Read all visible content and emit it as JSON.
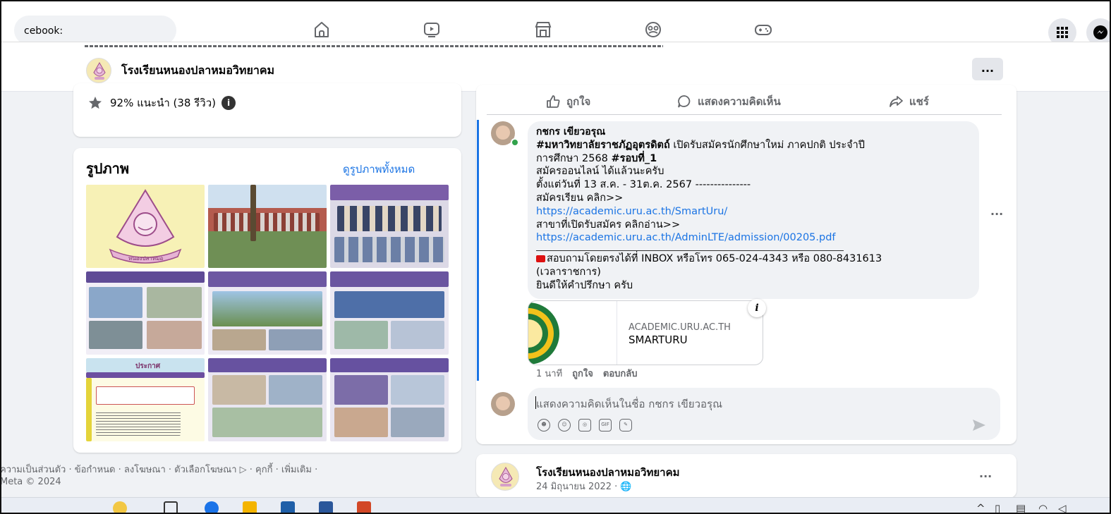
{
  "topnav": {
    "search_text": "cebook:",
    "nav_icons": [
      "home-icon",
      "video-icon",
      "marketplace-icon",
      "groups-icon",
      "gaming-icon"
    ],
    "right_icons": [
      "apps-grid-icon",
      "messenger-icon"
    ]
  },
  "page_header": {
    "name": "โรงเรียนหนองปลาหมอวิทยาคม",
    "more_label": "..."
  },
  "intro": {
    "rating_text": "92% แนะนำ (38 รีวิว)"
  },
  "photos": {
    "title": "รูปภาพ",
    "see_all": "ดูรูปภาพทั้งหมด",
    "tile_texts": {
      "logo_caption": "หนองปลาหมอ",
      "announce": "ประกาศ"
    }
  },
  "footer": {
    "line1": "ความเป็นส่วนตัว · ข้อกำหนด · ลงโฆษณา · ตัวเลือกโฆษณา ▷ · คุกกี้ · เพิ่มเติม ·",
    "line2": "Meta © 2024"
  },
  "post_actions": {
    "like": "ถูกใจ",
    "comment": "แสดงความคิดเห็น",
    "share": "แชร์"
  },
  "comment": {
    "author": "กชกร เขียวอรุณ",
    "hashtag1": "#มหาวิทยาลัยราชภัฏอุตรดิตถ์",
    "line1_rest": " เปิดรับสมัครนักศึกษาใหม่ ภาคปกติ ประจำปี",
    "line2_prefix": "การศึกษา 2568 ",
    "hashtag2": "#รอบที่_1",
    "line3": "สมัครออนไลน์ ได้แล้วนะครับ",
    "line4": "ตั้งแต่วันที่ 13 ส.ค. - 31ต.ค. 2567 ---------------",
    "line5": "สมัครเรียน คลิก>>",
    "link1": "https://academic.uru.ac.th/SmartUru/",
    "line6": "สาขาที่เปิดรับสมัคร คลิกอ่าน>>",
    "link2": "https://academic.uru.ac.th/AdminLTE/admission/00205.pdf",
    "line7": "สอบถามโดยตรงได้ที่ INBOX หรือโทร 065-024-4343 หรือ 080-8431613",
    "line8": "(เวลาราชการ)",
    "line9": "ยินดีให้คำปรึกษา ครับ",
    "more_label": "...",
    "preview": {
      "domain": "ACADEMIC.URU.AC.TH",
      "title": "SMARTURU",
      "info_badge": "i"
    },
    "meta": {
      "time": "1 นาที",
      "like": "ถูกใจ",
      "reply": "ตอบกลับ"
    }
  },
  "comment_input": {
    "placeholder": "แสดงความคิดเห็นในชื่อ กชกร เขียวอรุณ",
    "gif_label": "GIF",
    "tool_icons": [
      "avatar-sticker-icon",
      "emoji-icon",
      "camera-icon",
      "gif-icon",
      "sticker-icon"
    ]
  },
  "next_post": {
    "page_name": "โรงเรียนหนองปลาหมอวิทยาคม",
    "date": "24 มิถุนายน 2022 · ",
    "more_label": "..."
  },
  "colors": {
    "accent": "#1b74e4",
    "background": "#f0f2f5",
    "online": "#31a24c"
  }
}
